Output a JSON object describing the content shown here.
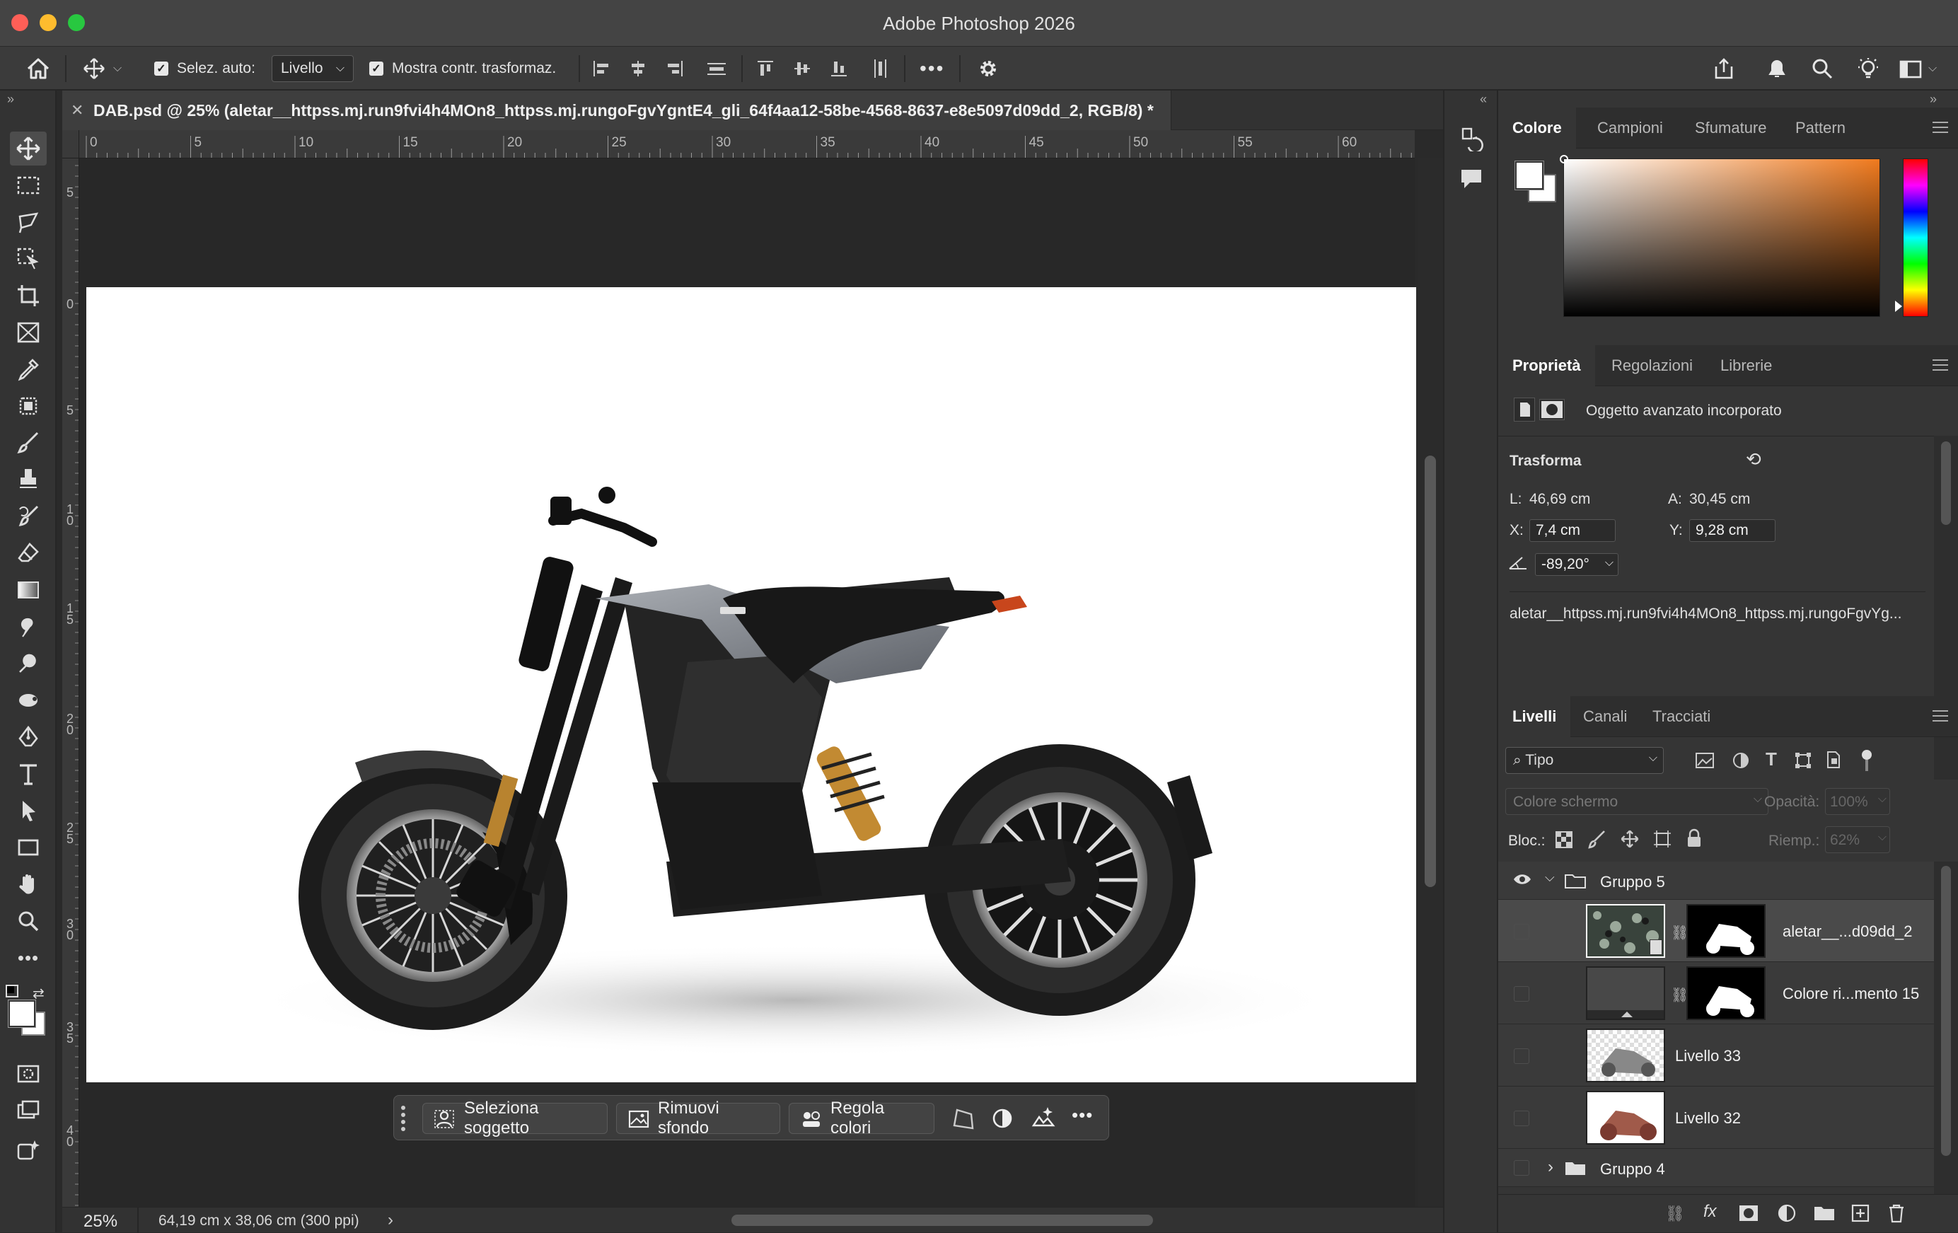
{
  "window": {
    "title": "Adobe Photoshop 2026"
  },
  "options_bar": {
    "auto_select_label": "Selez. auto:",
    "auto_select_value": "Livello",
    "show_transform_label": "Mostra contr. trasformaz."
  },
  "document_tab": {
    "title": "DAB.psd @ 25% (aletar__httpss.mj.run9fvi4h4MOn8_httpss.mj.rungoFgvYgntE4_gli_64f4aa12-58be-4568-8637-e8e5097d09dd_2, RGB/8) *"
  },
  "ruler_h": [
    "0",
    "5",
    "10",
    "15",
    "20",
    "25",
    "30",
    "35",
    "40",
    "45",
    "50",
    "55",
    "60"
  ],
  "ruler_v": [
    "5",
    "0",
    "5",
    "1",
    "0",
    "1",
    "5",
    "2",
    "0",
    "2",
    "5",
    "3",
    "0",
    "3",
    "5",
    "4",
    "0"
  ],
  "contextual_taskbar": {
    "select_subject": "Seleziona soggetto",
    "remove_bg": "Rimuovi sfondo",
    "adjust_colors": "Regola colori"
  },
  "status_bar": {
    "zoom": "25%",
    "doc_size": "64,19 cm x 38,06 cm (300 ppi)"
  },
  "color_panel": {
    "tabs": [
      "Colore",
      "Campioni",
      "Sfumature",
      "Pattern"
    ],
    "hue": "#f07a1e"
  },
  "properties_panel": {
    "tabs": [
      "Proprietà",
      "Regolazioni",
      "Librerie"
    ],
    "object_type": "Oggetto avanzato incorporato",
    "transform_title": "Trasforma",
    "w_label": "L:",
    "w_value": "46,69 cm",
    "h_label": "A:",
    "h_value": "30,45 cm",
    "x_label": "X:",
    "x_value": "7,4 cm",
    "y_label": "Y:",
    "y_value": "9,28 cm",
    "angle_value": "-89,20°",
    "layer_name": "aletar__httpss.mj.run9fvi4h4MOn8_httpss.mj.rungoFgvYg..."
  },
  "layers_panel": {
    "tabs": [
      "Livelli",
      "Canali",
      "Tracciati"
    ],
    "filter_value": "Tipo",
    "blend_mode": "Colore schermo",
    "opacity_label": "Opacità:",
    "opacity_value": "100%",
    "lock_label": "Bloc.:",
    "fill_label": "Riemp.:",
    "fill_value": "62%",
    "layers": [
      {
        "name": "Gruppo 5"
      },
      {
        "name": "aletar__...d09dd_2"
      },
      {
        "name": "Colore ri...mento 15"
      },
      {
        "name": "Livello 33"
      },
      {
        "name": "Livello 32"
      },
      {
        "name": "Gruppo 4"
      }
    ]
  }
}
